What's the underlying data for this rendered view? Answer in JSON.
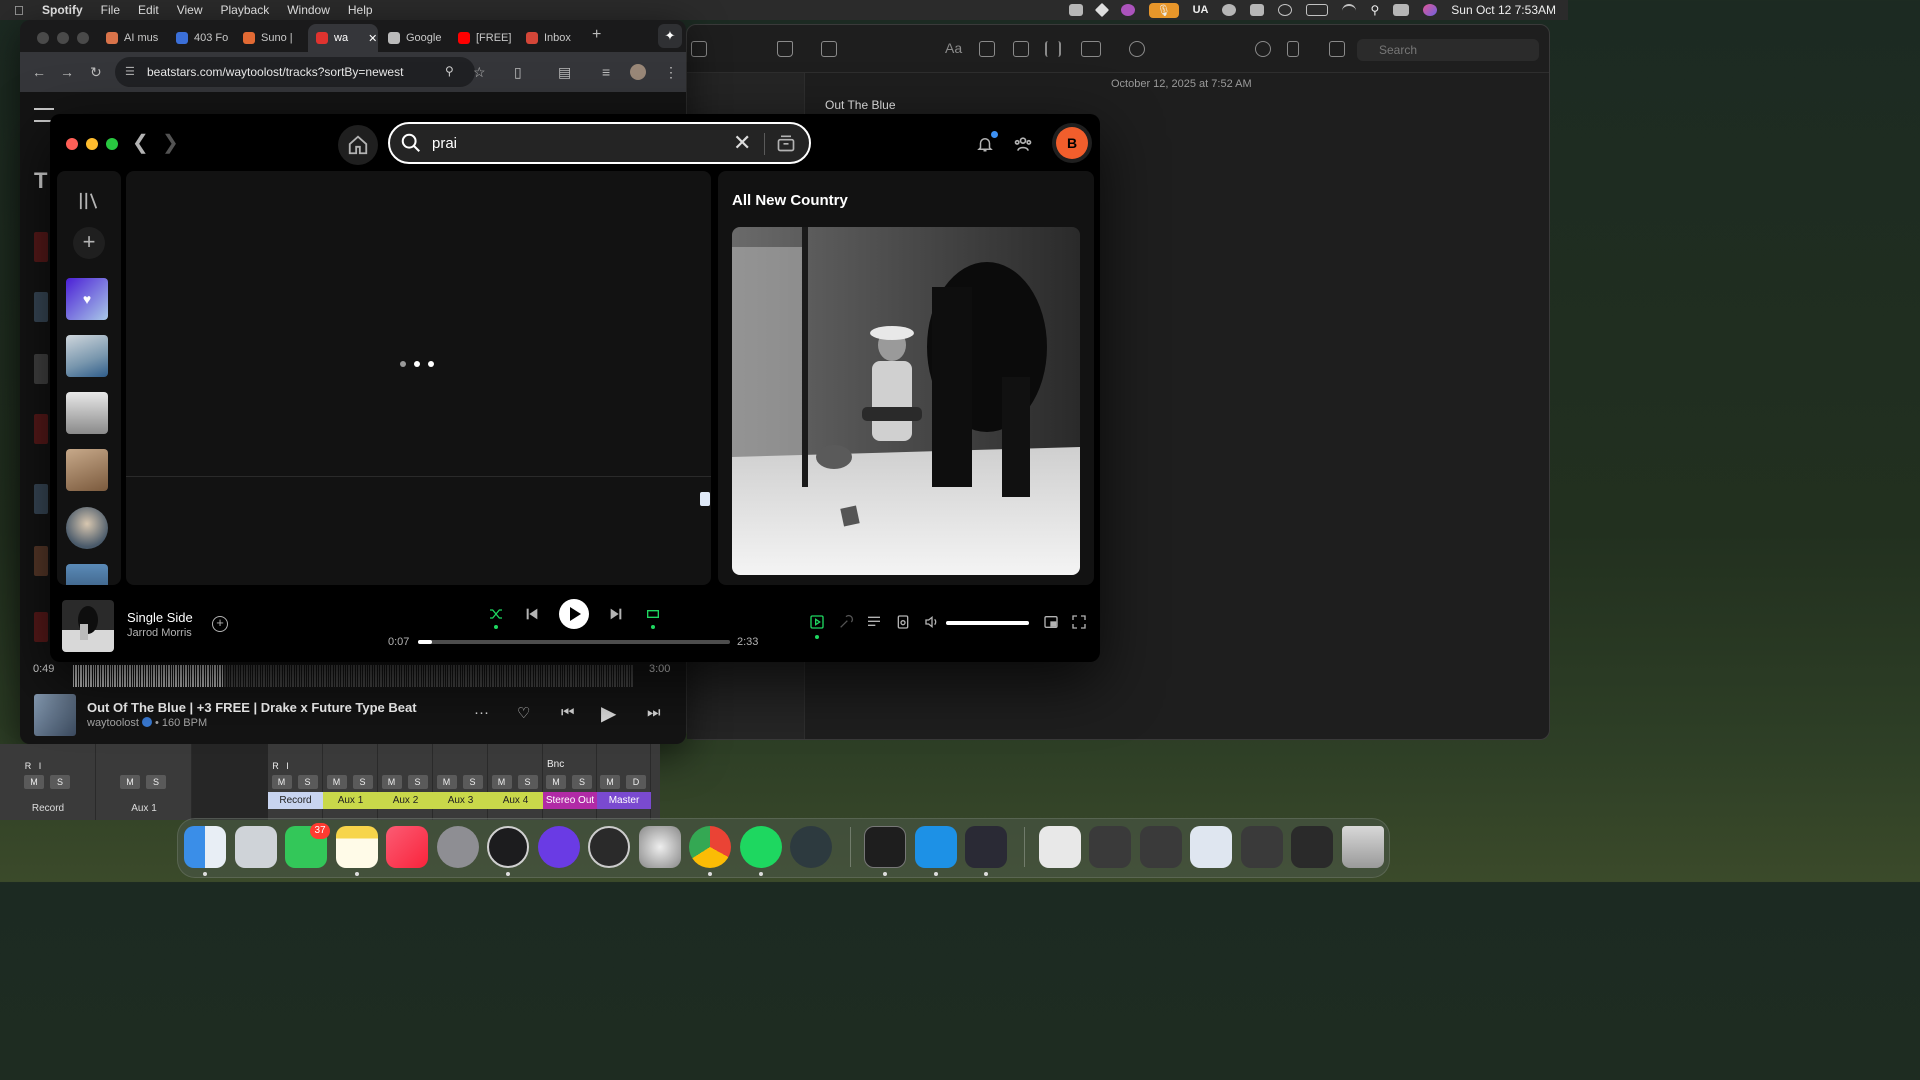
{
  "menubar": {
    "app_name": "Spotify",
    "menus": [
      "File",
      "Edit",
      "View",
      "Playback",
      "Window",
      "Help"
    ],
    "input_source": "UA",
    "clock": "Sun Oct 12  7:53AM"
  },
  "notes": {
    "search_placeholder": "Search",
    "note_date": "October 12, 2025 at 7:52 AM",
    "note_title": "Out The Blue"
  },
  "chrome": {
    "tabs": [
      {
        "label": "AI mus",
        "color": "#d9734a"
      },
      {
        "label": "403 Fo",
        "color": "#3b6fd8"
      },
      {
        "label": "Suno |",
        "color": "#e26a34"
      },
      {
        "label": "wa",
        "color": "#e0332f",
        "active": true
      },
      {
        "label": "Google",
        "color": "#bbbbbb"
      },
      {
        "label": "[FREE]",
        "color": "#ff0000"
      },
      {
        "label": "Inbox",
        "color": "#d44638"
      }
    ],
    "url": "beatstars.com/waytoolost/tracks?sortBy=newest"
  },
  "beatstars_player": {
    "time_elapsed": "0:49",
    "time_total": "3:00",
    "progress": 0.27,
    "title": "Out Of The Blue | +3 FREE | Drake x Future Type Beat",
    "artist": "waytoolost",
    "bpm_text": "• 160 BPM"
  },
  "mixer": {
    "channels": [
      {
        "name": "Record",
        "color": ""
      },
      {
        "name": "Aux 1",
        "color": ""
      },
      {
        "name": "Record",
        "color": "#c8d4f0"
      },
      {
        "name": "Aux 1",
        "color": "#c9d84a"
      },
      {
        "name": "Aux 2",
        "color": "#c9d84a"
      },
      {
        "name": "Aux 3",
        "color": "#c9d84a"
      },
      {
        "name": "Aux 4",
        "color": "#c9d84a"
      },
      {
        "name": "Stereo Out",
        "color": "#b12aa6"
      },
      {
        "name": "Master",
        "color": "#7a4ad0"
      }
    ],
    "bnc_label": "Bnc",
    "mute": "M",
    "solo": "S",
    "dim": "D",
    "rec": "R",
    "input": "I"
  },
  "spotify": {
    "search_value": "prai",
    "avatar_initial": "B",
    "right_panel_title": "All New Country",
    "now_playing": {
      "title": "Single Side",
      "artist": "Jarrod Morris",
      "time_current": "0:07",
      "time_total": "2:33",
      "progress": 0.045,
      "volume": 1.0
    },
    "colors": {
      "accent_green": "#1ed760",
      "avatar": "#f15e2c"
    }
  },
  "dock": {
    "messages_badge": "37",
    "apps": [
      "finder",
      "launchpad",
      "messages",
      "notes",
      "music",
      "system-settings",
      "logic-remote",
      "logic-pro",
      "mainstage",
      "compressor",
      "chrome",
      "spotify",
      "atom",
      "terminal",
      "docker",
      "audio-hijack",
      "music-document",
      "window-1",
      "window-2",
      "window-3",
      "window-4",
      "window-5",
      "trash"
    ]
  }
}
